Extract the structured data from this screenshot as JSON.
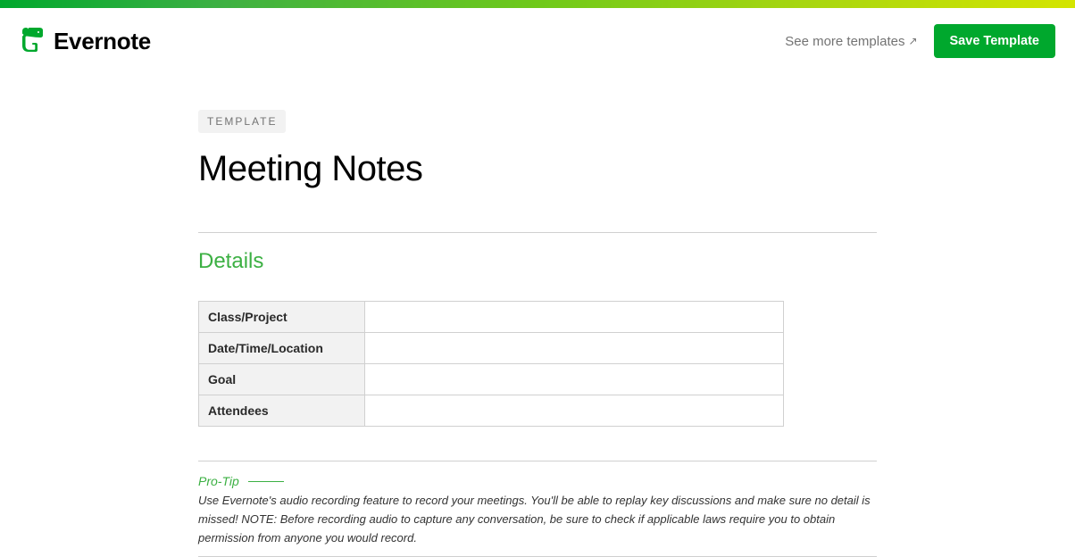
{
  "brand": {
    "name": "Evernote"
  },
  "header": {
    "see_more_label": "See more templates",
    "save_template_label": "Save Template"
  },
  "badge": {
    "label": "TEMPLATE"
  },
  "page": {
    "title": "Meeting Notes"
  },
  "sections": {
    "details": {
      "heading": "Details",
      "rows": [
        {
          "label": "Class/Project",
          "value": ""
        },
        {
          "label": "Date/Time/Location",
          "value": ""
        },
        {
          "label": "Goal",
          "value": ""
        },
        {
          "label": "Attendees",
          "value": ""
        }
      ]
    }
  },
  "protip": {
    "label": "Pro-Tip",
    "text": "Use Evernote's audio recording feature to record your meetings. You'll be able to replay key discussions and make sure no detail is missed! NOTE: Before recording audio to capture any conversation, be sure to check if applicable laws require you to obtain permission from anyone you would record."
  },
  "colors": {
    "accent": "#00a82d",
    "section_heading": "#3cb043"
  }
}
